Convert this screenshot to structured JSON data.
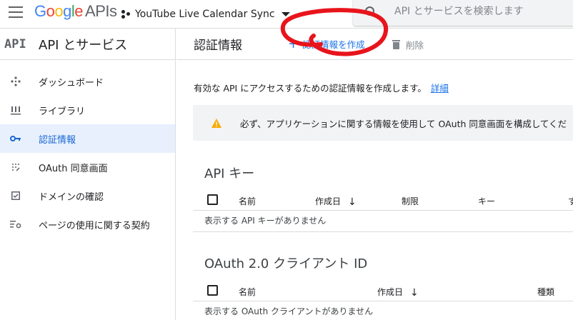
{
  "header": {
    "logo_parts": [
      "G",
      "o",
      "o",
      "g",
      "l",
      "e"
    ],
    "logo_suffix": "APIs",
    "project_name": "YouTube Live Calendar Sync",
    "search_placeholder": "API とサービスを検索します"
  },
  "sidebar": {
    "logo_text": "API",
    "title": "API とサービス",
    "items": [
      {
        "label": "ダッシュボード",
        "icon": "dashboard-icon"
      },
      {
        "label": "ライブラリ",
        "icon": "library-icon"
      },
      {
        "label": "認証情報",
        "icon": "key-icon",
        "active": true
      },
      {
        "label": "OAuth 同意画面",
        "icon": "consent-icon"
      },
      {
        "label": "ドメインの確認",
        "icon": "checkbox-icon"
      },
      {
        "label": "ページの使用に関する契約",
        "icon": "settings-list-icon"
      }
    ]
  },
  "main": {
    "page_title": "認証情報",
    "create_label": "認証情報を作成",
    "delete_label": "削除",
    "description": "有効な API にアクセスするための認証情報を作成します。",
    "details_link": "詳細",
    "warning": "必ず、アプリケーションに関する情報を使用して OAuth 同意画面を構成してくだ",
    "api_keys": {
      "title": "API キー",
      "columns": [
        "名前",
        "作成日",
        "制限",
        "キー",
        "す"
      ],
      "empty": "表示する API キーがありません"
    },
    "oauth": {
      "title": "OAuth 2.0 クライアント ID",
      "columns": [
        "名前",
        "作成日",
        "種類"
      ],
      "empty": "表示する OAuth クライアントがありません"
    }
  },
  "colors": {
    "accent": "#1a73e8",
    "active_bg": "#e8f0fe",
    "warning": "#f9ab00",
    "annotation_red": "#e8141c"
  }
}
